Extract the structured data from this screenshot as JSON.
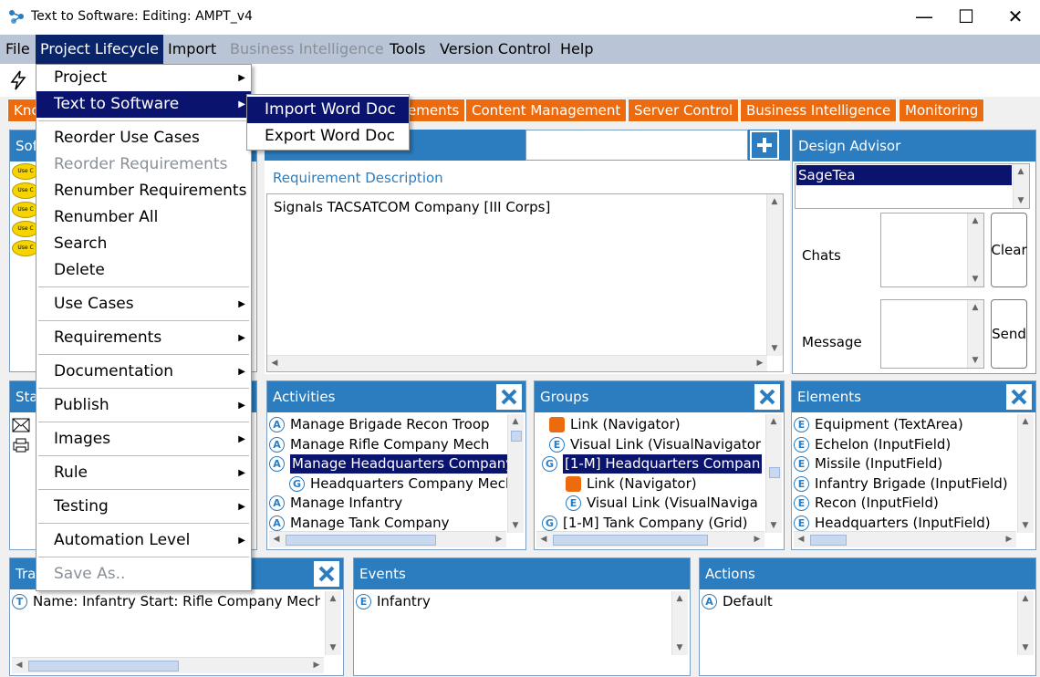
{
  "window": {
    "title": "Text to Software: Editing: AMPT_v4",
    "min": "—",
    "max": "☐",
    "close": "✕"
  },
  "menubar": [
    "File",
    "Project Lifecycle",
    "Import",
    "Business Intelligence",
    "Tools",
    "Version Control",
    "Help"
  ],
  "tabs": [
    "Kno",
    "ements",
    "Content Management",
    "Server Control",
    "Business Intelligence",
    "Monitoring"
  ],
  "project_menu": {
    "items": [
      {
        "label": "Project",
        "sub": true
      },
      {
        "label": "Text to Software",
        "sub": true
      },
      {
        "label": "Reorder Use Cases"
      },
      {
        "label": "Reorder Requirements",
        "disabled": true
      },
      {
        "label": "Renumber Requirements"
      },
      {
        "label": "Renumber All"
      },
      {
        "label": "Search"
      },
      {
        "label": "Delete"
      },
      {
        "label": "Use Cases",
        "sub": true
      },
      {
        "label": "Requirements",
        "sub": true
      },
      {
        "label": "Documentation",
        "sub": true
      },
      {
        "label": "Publish",
        "sub": true
      },
      {
        "label": "Images",
        "sub": true
      },
      {
        "label": "Rule",
        "sub": true
      },
      {
        "label": "Testing",
        "sub": true
      },
      {
        "label": "Automation Level",
        "sub": true
      },
      {
        "label": "Save As..",
        "disabled": true
      }
    ],
    "chevron": "▶"
  },
  "t2s_submenu": [
    "Import Word Doc",
    "Export Word Doc"
  ],
  "left_top": {
    "title": "Sof",
    "uc_label": "Use C"
  },
  "left_mid": {
    "title": "Sta"
  },
  "requirement": {
    "desc_label": "Requirement Description",
    "text": "Signals TACSATCOM Company [III Corps]",
    "add": "+"
  },
  "design_advisor": {
    "title": "Design Advisor",
    "selected": "SageTea",
    "chats_label": "Chats",
    "clear": "Clear",
    "message_label": "Message",
    "send": "Send"
  },
  "activities": {
    "title": "Activities",
    "items": [
      {
        "icon": "A",
        "text": "Manage Brigade Recon Troop"
      },
      {
        "icon": "A",
        "text": "Manage Rifle Company Mech"
      },
      {
        "icon": "A",
        "text": "Manage Headquarters Company",
        "selected": true
      },
      {
        "icon": "G",
        "text": "Headquarters Company Mech"
      },
      {
        "icon": "A",
        "text": "Manage Infantry"
      },
      {
        "icon": "A",
        "text": "Manage Tank Company"
      }
    ]
  },
  "groups": {
    "title": "Groups",
    "items": [
      {
        "icon": "link",
        "text": "Link (Navigator)"
      },
      {
        "icon": "E",
        "text": "Visual Link (VisualNavigator"
      },
      {
        "icon": "G",
        "text": "[1-M] Headquarters Compan",
        "selected": true
      },
      {
        "icon": "link",
        "text": "Link (Navigator)"
      },
      {
        "icon": "E",
        "text": "Visual Link (VisualNaviga"
      },
      {
        "icon": "G",
        "text": "[1-M] Tank Company (Grid)"
      }
    ]
  },
  "elements": {
    "title": "Elements",
    "items": [
      "Equipment (TextArea)",
      "Echelon (InputField)",
      "Missile (InputField)",
      "Infantry Brigade (InputField)",
      "Recon (InputField)",
      "Headquarters (InputField)"
    ]
  },
  "transitions": {
    "title": "Tra",
    "item": "Name: Infantry Start: Rifle Company Mech E"
  },
  "events": {
    "title": "Events",
    "item": "Infantry"
  },
  "actions": {
    "title": "Actions",
    "item": "Default"
  },
  "scroll": {
    "up": "▲",
    "down": "▼",
    "left": "◀",
    "right": "▶",
    "grip": "|||"
  },
  "colors": {
    "header_blue": "#2b7dbf",
    "tab_orange": "#ec6b0e",
    "selection": "#0a146e"
  }
}
